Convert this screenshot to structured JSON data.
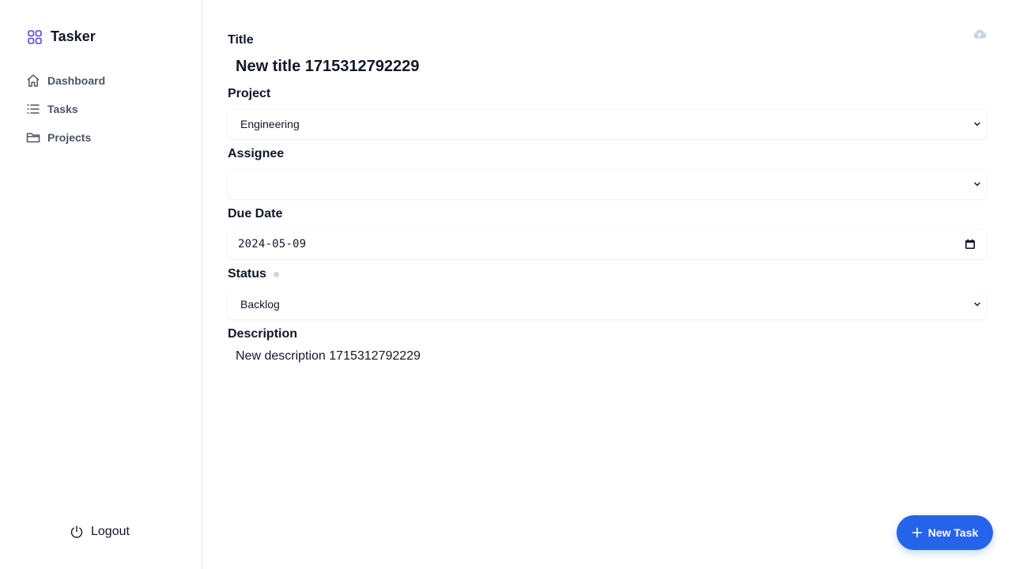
{
  "app": {
    "name": "Tasker",
    "accent": "#2563eb",
    "logo_color": "#4f46e5"
  },
  "sidebar": {
    "items": [
      {
        "label": "Dashboard",
        "icon": "home-icon"
      },
      {
        "label": "Tasks",
        "icon": "list-icon"
      },
      {
        "label": "Projects",
        "icon": "folder-icon"
      }
    ],
    "logout_label": "Logout",
    "logout_icon": "power-icon"
  },
  "form": {
    "title_label": "Title",
    "title_value": "New title 1715312792229",
    "project_label": "Project",
    "project_value": "Engineering",
    "assignee_label": "Assignee",
    "assignee_value": "",
    "due_label": "Due Date",
    "due_value": "2024-05-09",
    "status_label": "Status",
    "status_value": "Backlog",
    "description_label": "Description",
    "description_value": "New description 1715312792229",
    "upload_icon": "cloud-upload-icon"
  },
  "fab": {
    "label": "New Task",
    "icon": "plus-icon"
  }
}
